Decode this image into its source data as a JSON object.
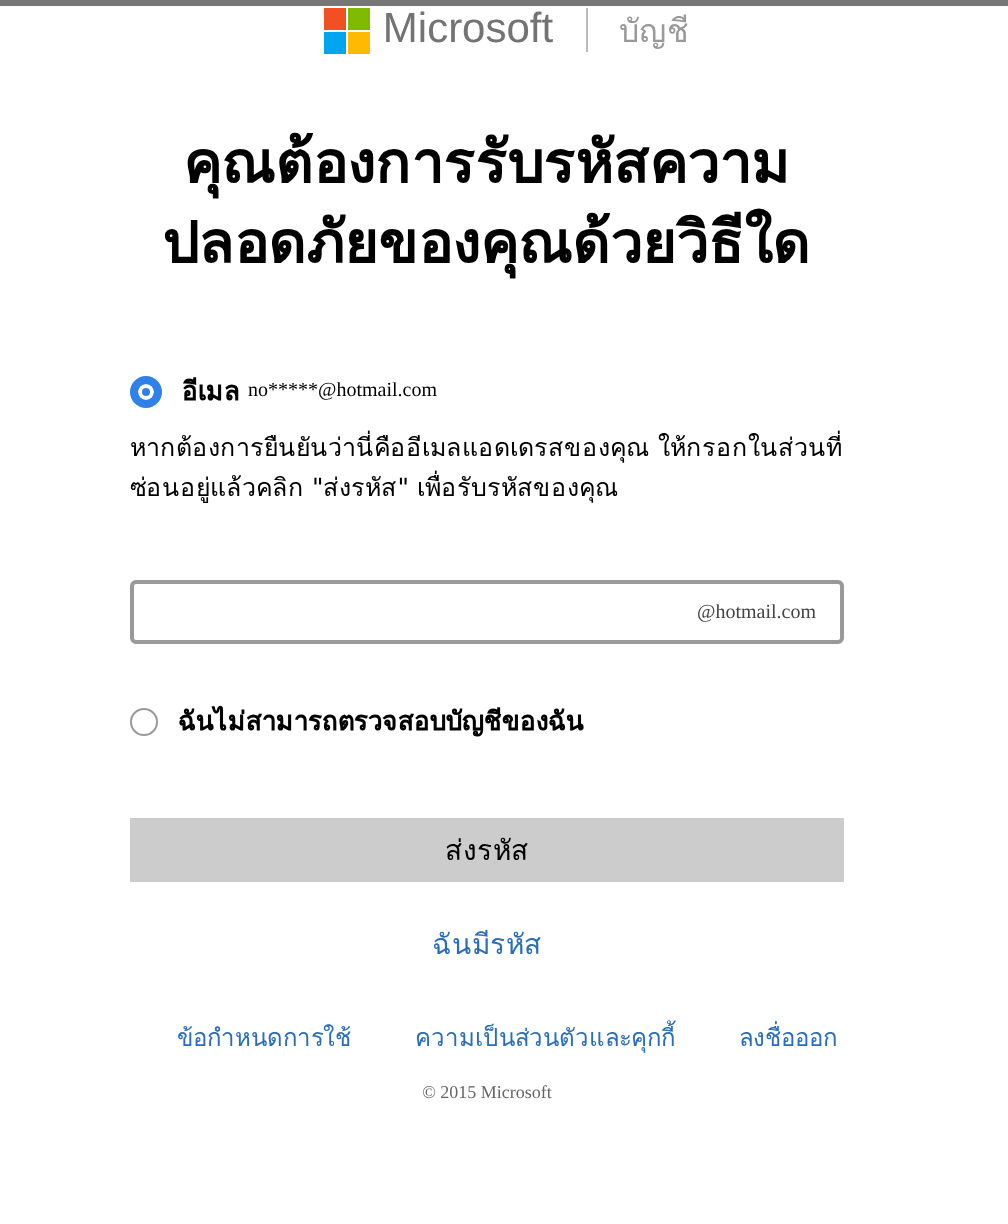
{
  "header": {
    "brand": "Microsoft",
    "section": "บัญชี"
  },
  "title": "คุณต้องการรับรหัสความปลอดภัยของคุณด้วยวิธีใด",
  "options": [
    {
      "kind": "email",
      "label": "อีเมล",
      "detail": "no*****@hotmail.com",
      "selected": true,
      "help": "หากต้องการยืนยันว่านี่คืออีเมลแอดเดรสของคุณ ให้กรอกในส่วนที่ซ่อนอยู่แล้วคลิก \"ส่งรหัส\" เพื่อรับรหัสของคุณ",
      "field_suffix": "@hotmail.com"
    },
    {
      "kind": "plain",
      "label": "ฉันไม่สามารถตรวจสอบบัญชีของฉัน",
      "selected": false
    }
  ],
  "submit": "ส่งรหัส",
  "have_code": "ฉันมีรหัส",
  "footer_links": [
    "ข้อกำหนดการใช้",
    "ความเป็นส่วนตัวและคุกกี้",
    "ลงชื่อออก"
  ],
  "copyright": "© 2015 Microsoft"
}
